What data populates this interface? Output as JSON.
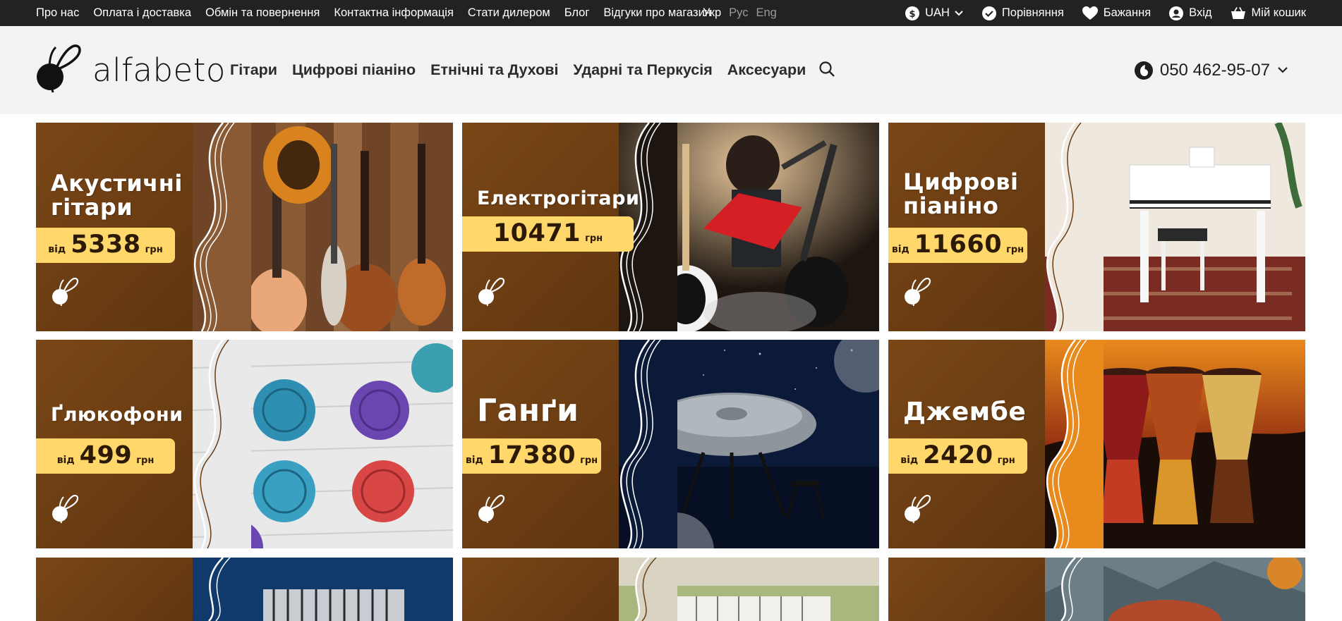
{
  "topbar": {
    "links": [
      "Про нас",
      "Оплата і доставка",
      "Обмін та повернення",
      "Контактна інформація",
      "Стати дилером",
      "Блог",
      "Відгуки про магазин"
    ],
    "languages": {
      "active": "Укр",
      "ru": "Рус",
      "en": "Eng"
    },
    "currency": "UAH",
    "compare": "Порівняння",
    "wishlist": "Бажання",
    "login": "Вхід",
    "cart": "Мій кошик"
  },
  "header": {
    "logo_text": "alfabeto",
    "nav": [
      "Гітари",
      "Цифрові піаніно",
      "Етнічні та Духові",
      "Ударні та Перкусія",
      "Аксесуари"
    ],
    "phone": "050 462-95-07"
  },
  "banners": [
    {
      "title_line1": "Акустичні",
      "title_line2": "гітари",
      "from": "від",
      "price": "5338",
      "currency": "грн"
    },
    {
      "title_line1": "Електрогітари",
      "title_line2": "",
      "from": "",
      "price": "10471",
      "currency": "грн"
    },
    {
      "title_line1": "Цифрові",
      "title_line2": "піаніно",
      "from": "від",
      "price": "11660",
      "currency": "грн"
    },
    {
      "title_line1": "Ґлюкофони",
      "title_line2": "",
      "from": "від",
      "price": "499",
      "currency": "грн"
    },
    {
      "title_line1": "Ганґи",
      "title_line2": "",
      "from": "від",
      "price": "17380",
      "currency": "грн"
    },
    {
      "title_line1": "Джембе",
      "title_line2": "",
      "from": "від",
      "price": "2420",
      "currency": "грн"
    }
  ],
  "colors": {
    "topbar_bg": "#222222",
    "header_bg": "#f3f3f3",
    "banner_brown": "#6b3d12",
    "price_yellow": "#ffd76b"
  }
}
